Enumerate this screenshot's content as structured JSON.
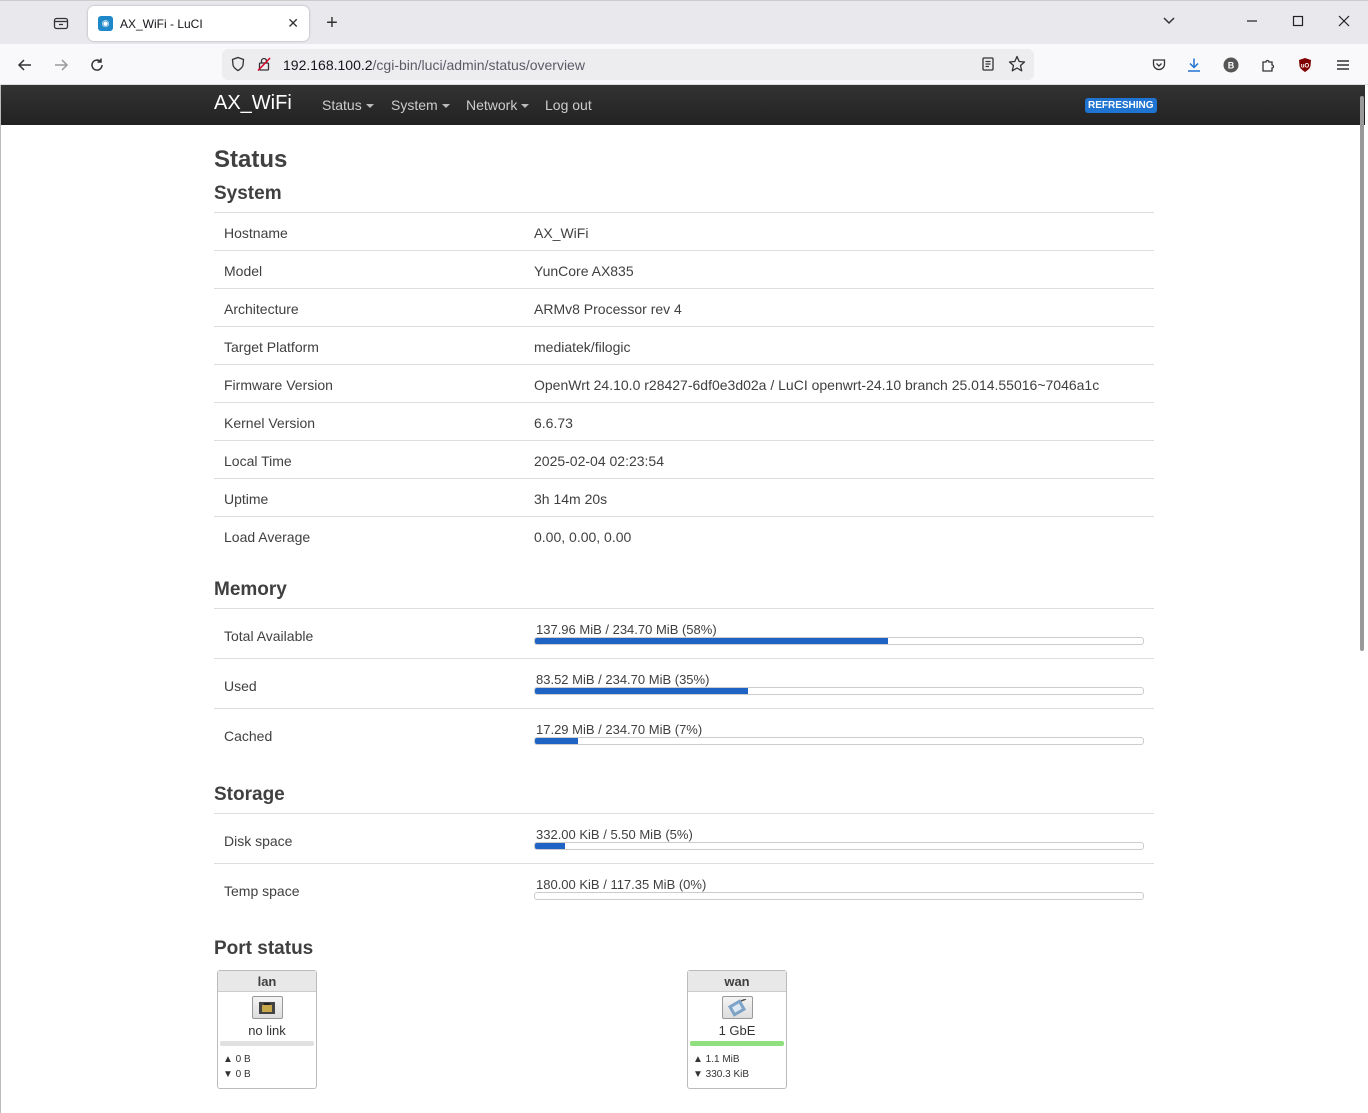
{
  "browser": {
    "tab_title": "AX_WiFi - LuCI",
    "url_host": "192.168.100.2",
    "url_path": "/cgi-bin/luci/admin/status/overview"
  },
  "header": {
    "brand": "AX_WiFi",
    "menu": [
      "Status",
      "System",
      "Network",
      "Log out"
    ],
    "badge": "REFRESHING"
  },
  "page": {
    "title": "Status"
  },
  "system": {
    "heading": "System",
    "rows": [
      {
        "label": "Hostname",
        "value": "AX_WiFi"
      },
      {
        "label": "Model",
        "value": "YunCore AX835"
      },
      {
        "label": "Architecture",
        "value": "ARMv8 Processor rev 4"
      },
      {
        "label": "Target Platform",
        "value": "mediatek/filogic"
      },
      {
        "label": "Firmware Version",
        "value": "OpenWrt 24.10.0 r28427-6df0e3d02a / LuCI openwrt-24.10 branch 25.014.55016~7046a1c"
      },
      {
        "label": "Kernel Version",
        "value": "6.6.73"
      },
      {
        "label": "Local Time",
        "value": "2025-02-04 02:23:54"
      },
      {
        "label": "Uptime",
        "value": "3h 14m 20s"
      },
      {
        "label": "Load Average",
        "value": "0.00, 0.00, 0.00"
      }
    ]
  },
  "memory": {
    "heading": "Memory",
    "rows": [
      {
        "label": "Total Available",
        "text": "137.96 MiB / 234.70 MiB (58%)",
        "percent": 58
      },
      {
        "label": "Used",
        "text": "83.52 MiB / 234.70 MiB (35%)",
        "percent": 35
      },
      {
        "label": "Cached",
        "text": "17.29 MiB / 234.70 MiB (7%)",
        "percent": 7
      }
    ]
  },
  "storage": {
    "heading": "Storage",
    "rows": [
      {
        "label": "Disk space",
        "text": "332.00 KiB / 5.50 MiB (5%)",
        "percent": 5
      },
      {
        "label": "Temp space",
        "text": "180.00 KiB / 117.35 MiB (0%)",
        "percent": 0
      }
    ]
  },
  "ports": {
    "heading": "Port status",
    "items": [
      {
        "name": "lan",
        "speed": "no link",
        "tx": "▲ 0 B",
        "rx": "▼ 0 B",
        "link_color": "#e0e0e0"
      },
      {
        "name": "wan",
        "speed": "1 GbE",
        "tx": "▲ 1.1 MiB",
        "rx": "▼ 330.3 KiB",
        "link_color": "#90e080"
      }
    ]
  }
}
